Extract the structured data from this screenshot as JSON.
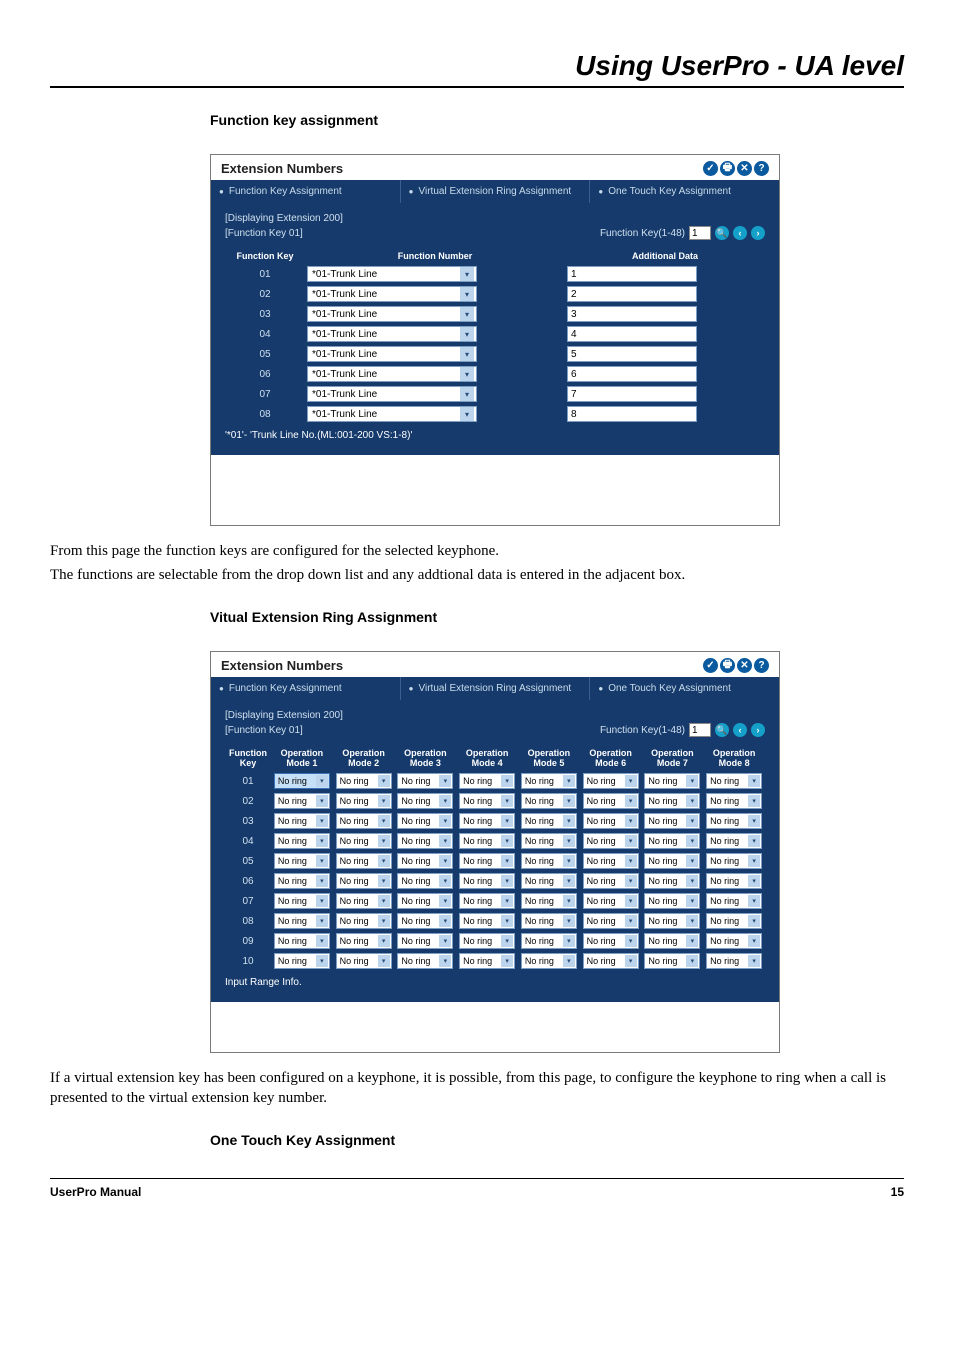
{
  "header": {
    "title": "Using UserPro - UA level"
  },
  "footer": {
    "left": "UserPro Manual",
    "right": "15"
  },
  "sections": {
    "fka": {
      "heading": "Function key assignment",
      "panel_title": "Extension Numbers",
      "tabs": [
        "Function Key Assignment",
        "Virtual Extension Ring Assignment",
        "One Touch Key Assignment"
      ],
      "displaying": "[Displaying Extension 200]",
      "subhead": "[Function Key 01]",
      "fk_label": "Function Key(1-48)",
      "fk_value": "1",
      "cols": [
        "Function Key",
        "Function Number",
        "Additional Data"
      ],
      "rows": [
        {
          "key": "01",
          "fn": "*01-Trunk Line",
          "ad": "1"
        },
        {
          "key": "02",
          "fn": "*01-Trunk Line",
          "ad": "2"
        },
        {
          "key": "03",
          "fn": "*01-Trunk Line",
          "ad": "3"
        },
        {
          "key": "04",
          "fn": "*01-Trunk Line",
          "ad": "4"
        },
        {
          "key": "05",
          "fn": "*01-Trunk Line",
          "ad": "5"
        },
        {
          "key": "06",
          "fn": "*01-Trunk Line",
          "ad": "6"
        },
        {
          "key": "07",
          "fn": "*01-Trunk Line",
          "ad": "7"
        },
        {
          "key": "08",
          "fn": "*01-Trunk Line",
          "ad": "8"
        }
      ],
      "footnote": "'*01'- 'Trunk Line No.(ML:001-200 VS:1-8)'"
    },
    "vera": {
      "heading": "Vitual Extension Ring Assignment",
      "panel_title": "Extension Numbers",
      "tabs": [
        "Function Key Assignment",
        "Virtual Extension Ring Assignment",
        "One Touch Key Assignment"
      ],
      "displaying": "[Displaying Extension 200]",
      "subhead": "[Function Key 01]",
      "fk_label": "Function Key(1-48)",
      "fk_value": "1",
      "cols": [
        "Function Key",
        "Operation Mode 1",
        "Operation Mode 2",
        "Operation Mode 3",
        "Operation Mode 4",
        "Operation Mode 5",
        "Operation Mode 6",
        "Operation Mode 7",
        "Operation Mode 8"
      ],
      "row_keys": [
        "01",
        "02",
        "03",
        "04",
        "05",
        "06",
        "07",
        "08",
        "09",
        "10"
      ],
      "cell_value": "No ring",
      "input_range": "Input Range Info."
    },
    "otka": {
      "heading": "One Touch Key Assignment"
    }
  },
  "paragraphs": {
    "p1a": "From this page the function keys are configured for the selected keyphone.",
    "p1b": "The functions are selectable from the drop down list and any addtional data is entered in the adjacent box.",
    "p2": "If a virtual extension key has been configured on a keyphone, it is possible, from this page, to configure the keyphone to ring when a call is presented to the virtual extension key number."
  },
  "icons": {
    "apply": "✓",
    "print": "🖶",
    "close": "✕",
    "help": "?",
    "search": "🔍",
    "prev": "‹",
    "next": "›"
  }
}
